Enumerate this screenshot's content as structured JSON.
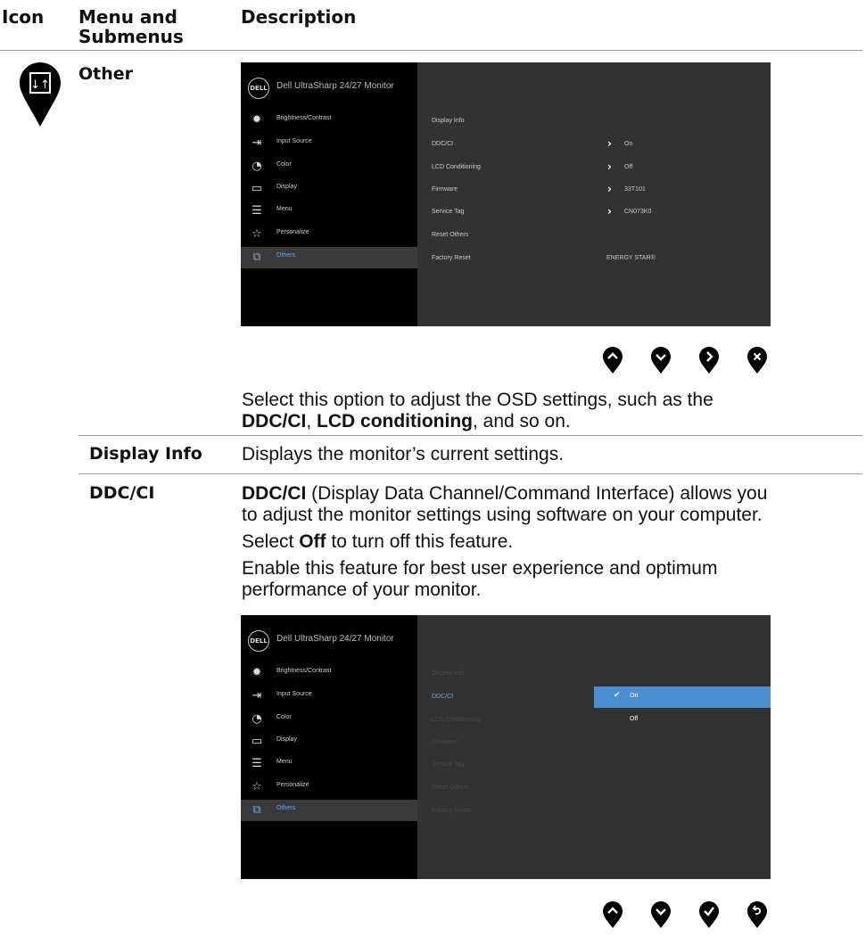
{
  "header": {
    "icon": "Icon",
    "menu": "Menu and Submenus",
    "description": "Description"
  },
  "section": {
    "name": "Other"
  },
  "osd": {
    "title": "Dell UltraSharp 24/27 Monitor",
    "logo": "DELL",
    "menu": [
      "Brightness/Contrast",
      "Input Source",
      "Color",
      "Display",
      "Menu",
      "Personalize",
      "Others"
    ],
    "menu_icons": [
      "brightness-icon",
      "input-source-icon",
      "color-palette-icon",
      "display-icon",
      "menu-icon",
      "star-icon",
      "others-icon"
    ],
    "submenu": [
      "Display Info",
      "DDC/CI",
      "LCD Conditioning",
      "Firmware",
      "Service Tag",
      "Reset Others",
      "Factory Reset"
    ],
    "values": {
      "ddc": "On",
      "lcd": "Off",
      "firmware": "33T101",
      "service_tag": "CN073K0",
      "energy": "ENERGY STAR®"
    },
    "options": [
      "On",
      "Off"
    ]
  },
  "buttons1": [
    "up",
    "down",
    "right",
    "close"
  ],
  "buttons2": [
    "up",
    "down",
    "check",
    "back"
  ],
  "intro": {
    "t1": "Select this option to adjust the OSD settings, such as the",
    "b1": "DDC/CI",
    "t2": ", ",
    "b2": "LCD conditioning",
    "t3": ", and so on."
  },
  "display_info": {
    "label": "Display Info",
    "desc": "Displays the monitor’s current settings."
  },
  "ddc": {
    "label": "DDC/CI",
    "p1_bold": "DDC/CI",
    "p1_line1": " (Display Data Channel/Command Interface) allows you",
    "p1_line2": "to adjust the monitor settings using software on your computer.",
    "p2_a": "Select ",
    "p2_b": "Off",
    "p2_c": " to turn off this feature.",
    "p3_line1": "Enable this feature for best user experience and optimum",
    "p3_line2": "performance of your monitor."
  }
}
